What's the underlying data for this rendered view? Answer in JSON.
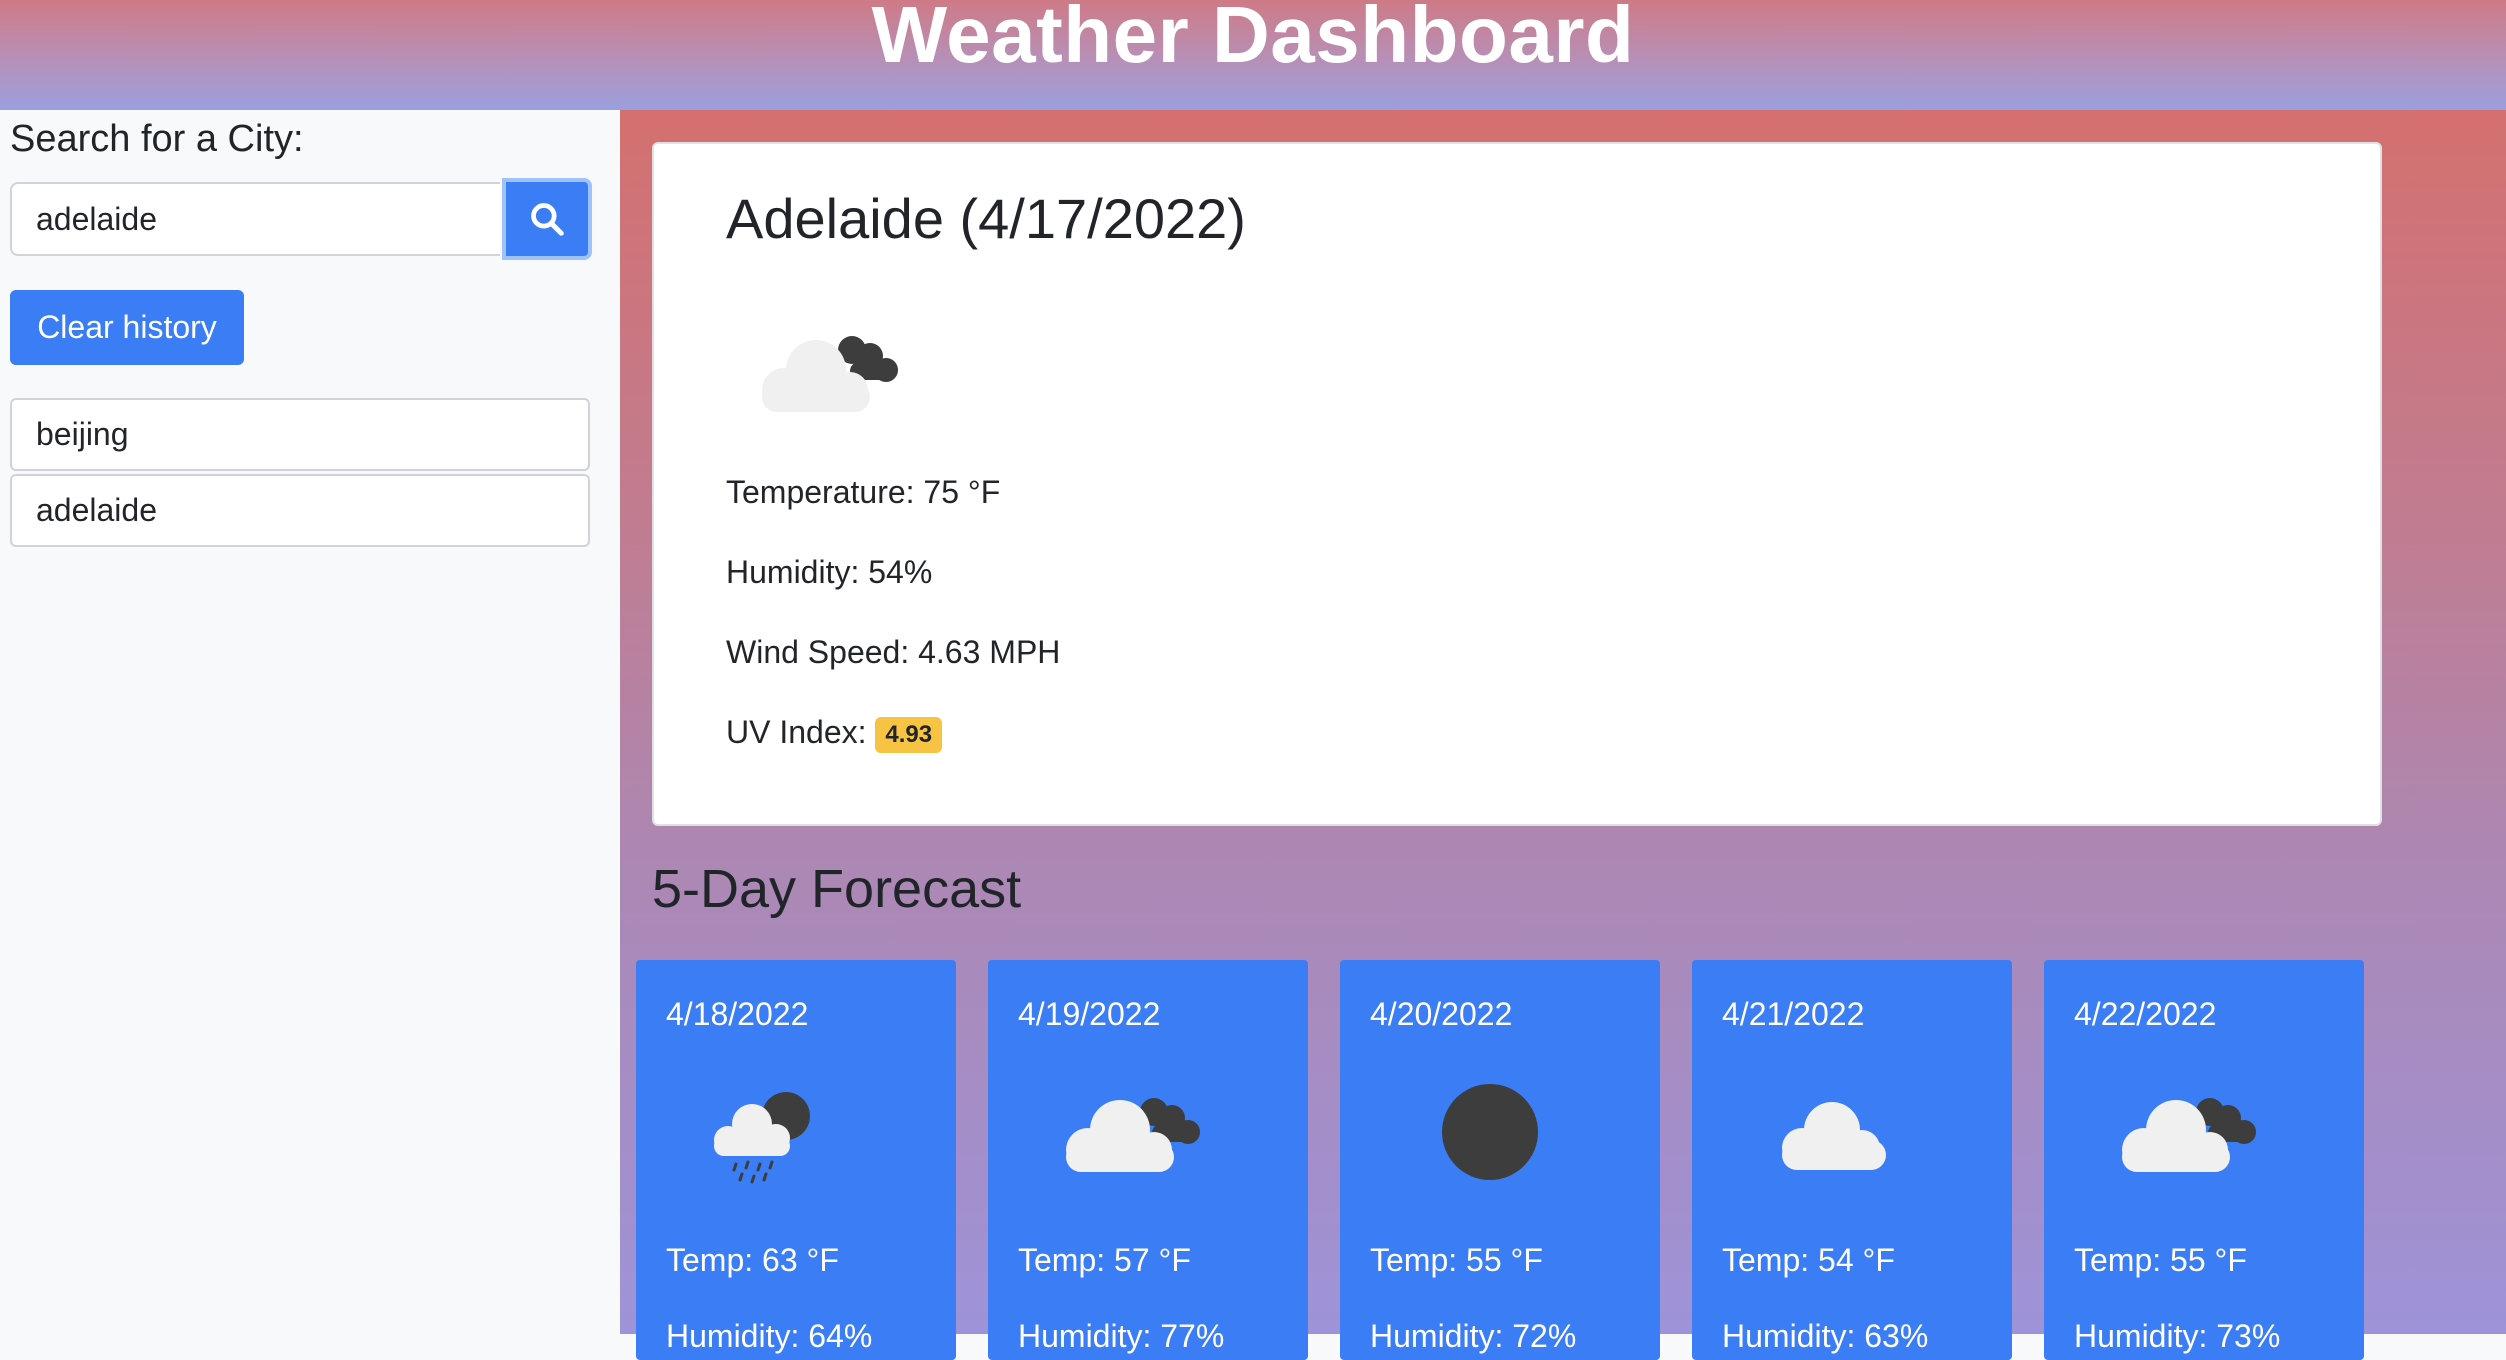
{
  "header": {
    "title": "Weather Dashboard"
  },
  "sidebar": {
    "search_label": "Search for a City:",
    "search_value": "adelaide",
    "clear_label": "Clear history",
    "history": [
      "beijing",
      "adelaide"
    ]
  },
  "current": {
    "title": "Adelaide (4/17/2022)",
    "icon": "partly-cloudy-icon",
    "temperature": "Temperature: 75 °F",
    "humidity": "Humidity: 54%",
    "wind": "Wind Speed: 4.63 MPH",
    "uv_label": "UV Index:",
    "uv_value": "4.93",
    "uv_color": "#f6c342"
  },
  "forecast": {
    "title": "5-Day Forecast",
    "days": [
      {
        "date": "4/18/2022",
        "icon": "rain-cloud-icon",
        "temp": "Temp: 63 °F",
        "humidity": "Humidity: 64%"
      },
      {
        "date": "4/19/2022",
        "icon": "broken-clouds-icon",
        "temp": "Temp: 57 °F",
        "humidity": "Humidity: 77%"
      },
      {
        "date": "4/20/2022",
        "icon": "clear-sky-icon",
        "temp": "Temp: 55 °F",
        "humidity": "Humidity: 72%"
      },
      {
        "date": "4/21/2022",
        "icon": "cloud-icon",
        "temp": "Temp: 54 °F",
        "humidity": "Humidity: 63%"
      },
      {
        "date": "4/22/2022",
        "icon": "broken-clouds-icon",
        "temp": "Temp: 55 °F",
        "humidity": "Humidity: 73%"
      }
    ]
  },
  "colors": {
    "accent": "#3b7df4",
    "uv_badge": "#f6c342"
  }
}
